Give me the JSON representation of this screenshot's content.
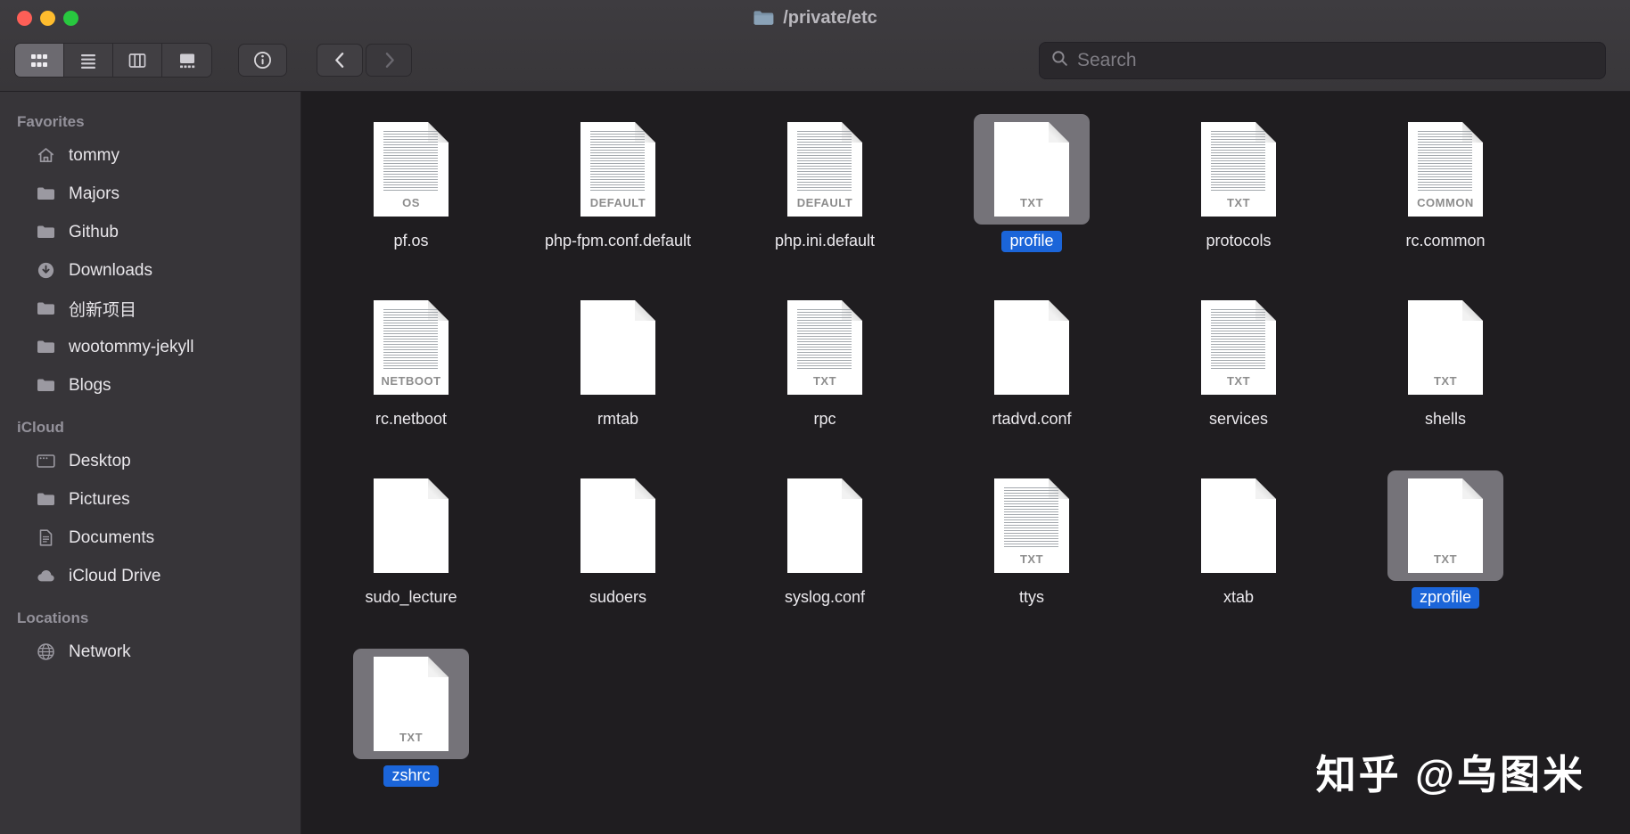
{
  "window": {
    "title": "/private/etc"
  },
  "toolbar": {
    "search_placeholder": "Search"
  },
  "colors": {
    "accent_blue": "#1b65d9",
    "traffic_red": "#fe5f57",
    "traffic_yellow": "#febc2e",
    "traffic_green": "#28c83f",
    "selection_plate": "#757379"
  },
  "sidebar": {
    "sections": [
      {
        "title": "Favorites",
        "items": [
          {
            "label": "tommy",
            "icon": "home-icon"
          },
          {
            "label": "Majors",
            "icon": "folder-icon"
          },
          {
            "label": "Github",
            "icon": "folder-icon"
          },
          {
            "label": "Downloads",
            "icon": "download-icon"
          },
          {
            "label": "创新项目",
            "icon": "folder-icon"
          },
          {
            "label": "wootommy-jekyll",
            "icon": "folder-icon"
          },
          {
            "label": "Blogs",
            "icon": "folder-icon"
          }
        ]
      },
      {
        "title": "iCloud",
        "items": [
          {
            "label": "Desktop",
            "icon": "desktop-icon"
          },
          {
            "label": "Pictures",
            "icon": "folder-icon"
          },
          {
            "label": "Documents",
            "icon": "documents-icon"
          },
          {
            "label": "iCloud Drive",
            "icon": "cloud-icon"
          }
        ]
      },
      {
        "title": "Locations",
        "items": [
          {
            "label": "Network",
            "icon": "globe-icon"
          }
        ]
      }
    ]
  },
  "files": [
    {
      "name": "pf.os",
      "badge": "OS",
      "textured": true,
      "selected": false
    },
    {
      "name": "php-fpm.conf.default",
      "badge": "DEFAULT",
      "textured": true,
      "selected": false
    },
    {
      "name": "php.ini.default",
      "badge": "DEFAULT",
      "textured": true,
      "selected": false
    },
    {
      "name": "profile",
      "badge": "TXT",
      "textured": false,
      "selected": true
    },
    {
      "name": "protocols",
      "badge": "TXT",
      "textured": true,
      "selected": false
    },
    {
      "name": "rc.common",
      "badge": "COMMON",
      "textured": true,
      "selected": false
    },
    {
      "name": "rc.netboot",
      "badge": "NETBOOT",
      "textured": true,
      "selected": false
    },
    {
      "name": "rmtab",
      "badge": "",
      "textured": false,
      "selected": false
    },
    {
      "name": "rpc",
      "badge": "TXT",
      "textured": true,
      "selected": false
    },
    {
      "name": "rtadvd.conf",
      "badge": "",
      "textured": false,
      "selected": false
    },
    {
      "name": "services",
      "badge": "TXT",
      "textured": true,
      "selected": false
    },
    {
      "name": "shells",
      "badge": "TXT",
      "textured": false,
      "selected": false
    },
    {
      "name": "sudo_lecture",
      "badge": "",
      "textured": false,
      "selected": false
    },
    {
      "name": "sudoers",
      "badge": "",
      "textured": false,
      "selected": false
    },
    {
      "name": "syslog.conf",
      "badge": "",
      "textured": false,
      "selected": false
    },
    {
      "name": "ttys",
      "badge": "TXT",
      "textured": true,
      "selected": false
    },
    {
      "name": "xtab",
      "badge": "",
      "textured": false,
      "selected": false
    },
    {
      "name": "zprofile",
      "badge": "TXT",
      "textured": false,
      "selected": true
    },
    {
      "name": "zshrc",
      "badge": "TXT",
      "textured": false,
      "selected": true
    }
  ],
  "watermark": "知乎 @乌图米"
}
